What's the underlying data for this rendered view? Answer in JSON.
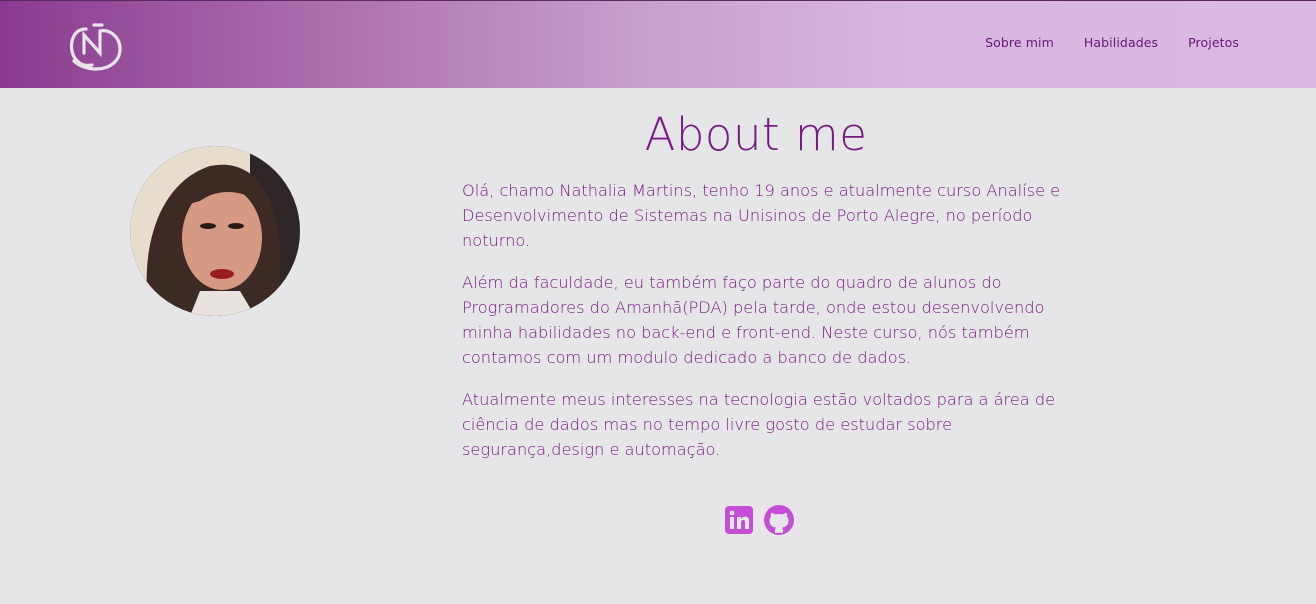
{
  "header": {
    "logo_icon": "nj-monogram-logo",
    "nav": [
      {
        "label": "Sobre mim"
      },
      {
        "label": "Habilidades"
      },
      {
        "label": "Projetos"
      }
    ]
  },
  "about": {
    "title": "About me",
    "paragraphs": [
      "Olá, chamo Nathalia Martins, tenho 19 anos e atualmente curso Analíse e Desenvolvimento de Sistemas na Unisinos de Porto Alegre, no período noturno.",
      "Além da faculdade, eu também faço parte do quadro de alunos do Programadores do Amanhã(PDA) pela tarde, onde estou desenvolvendo minha habilidades no back-end e front-end. Neste curso, nós também contamos com um modulo dedicado a banco de dados.",
      "Atualmente meus interesses na tecnologia estão voltados para a área de ciência de dados mas no tempo livre gosto de estudar sobre segurança,design e automação."
    ],
    "social_icons": [
      "linkedin-icon",
      "github-icon"
    ]
  },
  "colors": {
    "accent": "#7a1a85",
    "icon": "#c44fd6",
    "background": "#e6e5e7"
  }
}
